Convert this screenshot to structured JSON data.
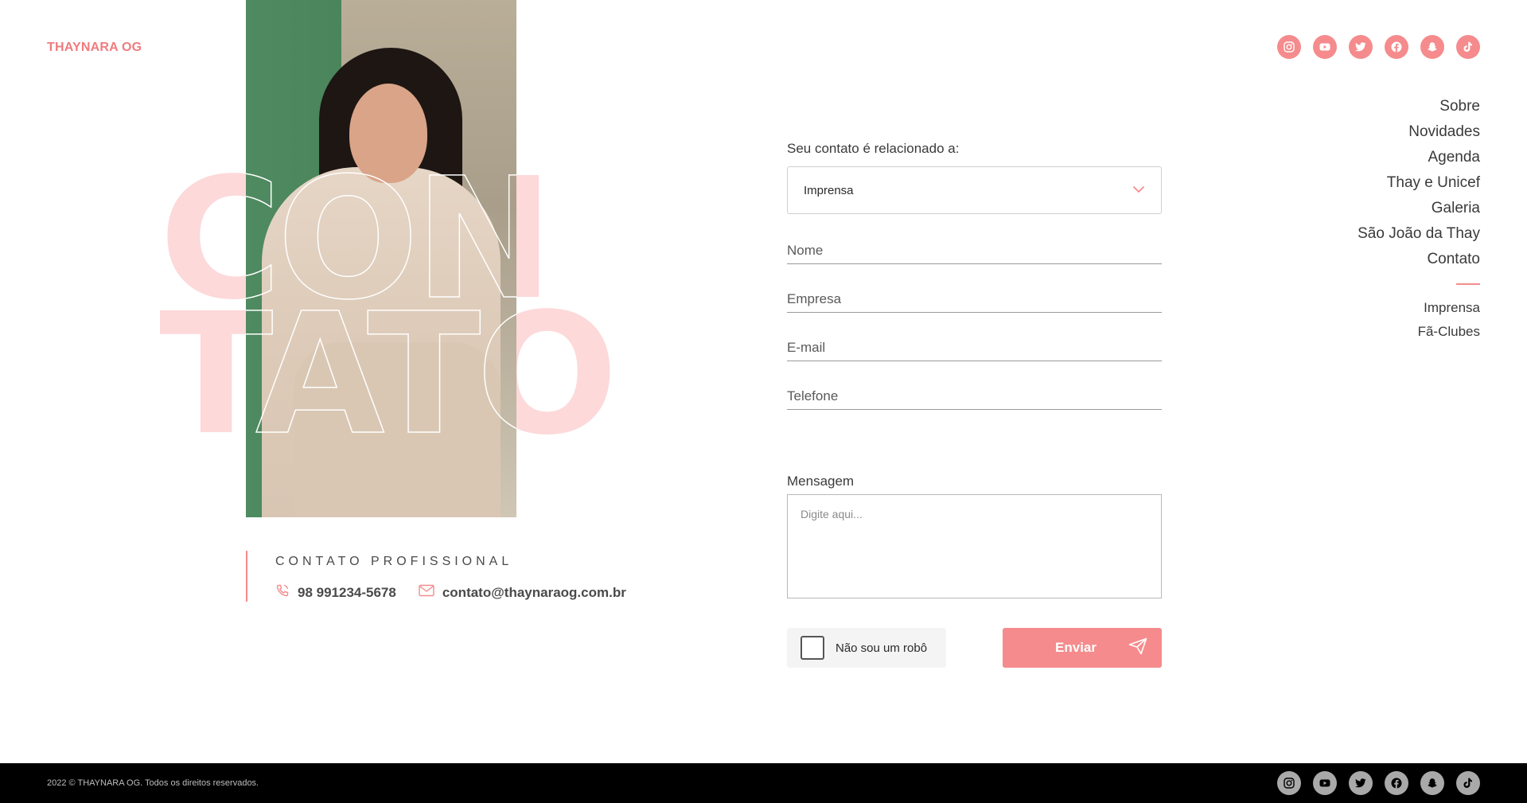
{
  "brand": {
    "logo": "THAYNARA OG",
    "accent_color": "#f58b8c"
  },
  "social": [
    {
      "name": "instagram-icon"
    },
    {
      "name": "youtube-icon"
    },
    {
      "name": "twitter-icon"
    },
    {
      "name": "facebook-icon"
    },
    {
      "name": "snapchat-icon"
    },
    {
      "name": "tiktok-icon"
    }
  ],
  "nav": {
    "items": [
      "Sobre",
      "Novidades",
      "Agenda",
      "Thay e Unicef",
      "Galeria",
      "São João da Thay",
      "Contato"
    ],
    "sub_items": [
      "Imprensa",
      "Fã-Clubes"
    ]
  },
  "hero": {
    "word_line1": "CON",
    "word_line2": "TATO"
  },
  "contact": {
    "heading": "CONTATO PROFISSIONAL",
    "phone": "98 991234-5678",
    "email": "contato@thaynaraog.com.br"
  },
  "form": {
    "topic_label": "Seu contato é relacionado a:",
    "topic_value": "Imprensa",
    "name_placeholder": "Nome",
    "company_placeholder": "Empresa",
    "email_placeholder": "E-mail",
    "phone_placeholder": "Telefone",
    "message_label": "Mensagem",
    "message_placeholder": "Digite aqui...",
    "captcha_label": "Não sou um robô",
    "submit_label": "Enviar"
  },
  "footer": {
    "copyright": "2022 © THAYNARA OG. Todos os direitos reservados."
  }
}
